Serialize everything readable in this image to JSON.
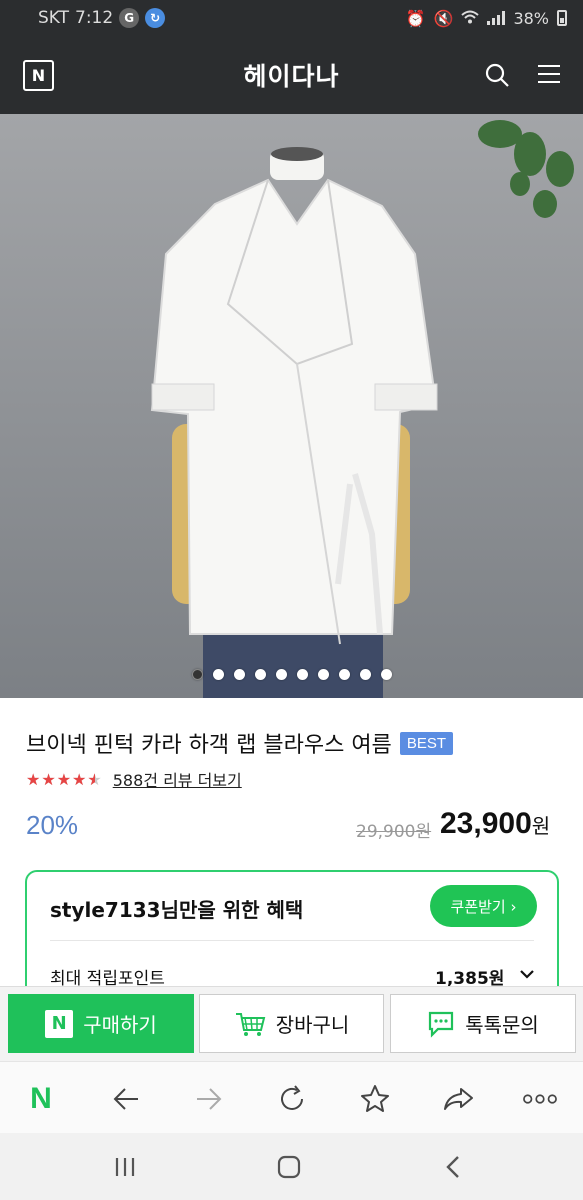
{
  "status_bar": {
    "carrier": "SKT",
    "time": "7:12",
    "app_icon_1": "G",
    "battery": "38%"
  },
  "header": {
    "logo_letter": "N",
    "title": "헤이다나",
    "icons": [
      "search-icon",
      "menu-icon"
    ]
  },
  "gallery": {
    "total_images": 10,
    "current_index": 1
  },
  "product": {
    "title": "브이넥 핀턱 카라 하객 랩 블라우스 여름",
    "badge": "BEST",
    "rating": 4.5,
    "rating_max": 5,
    "stars_text": "★★★★★",
    "review_link": "588건 리뷰 더보기",
    "discount": "20%",
    "original_price": "29,900원",
    "sale_price": "23,900",
    "currency": "원"
  },
  "benefit": {
    "title": "style7133님만을 위한 혜택",
    "coupon_button": "쿠폰받기 ›",
    "points_label": "최대 적립포인트",
    "points_value": "1,385원"
  },
  "actions": {
    "buy_logo": "N",
    "buy": "구매하기",
    "cart": "장바구니",
    "talk": "톡톡문의"
  },
  "browser_bar": {
    "logo": "N",
    "icons": [
      "back-arrow-icon",
      "forward-arrow-icon",
      "refresh-icon",
      "star-icon",
      "share-icon",
      "more-icon"
    ]
  },
  "colors": {
    "header_bg": "#2b2d2f",
    "naver_green": "#1fc15a",
    "discount_blue": "#5a83c8",
    "best_badge": "#5a8de2",
    "star_red": "#e64545"
  }
}
